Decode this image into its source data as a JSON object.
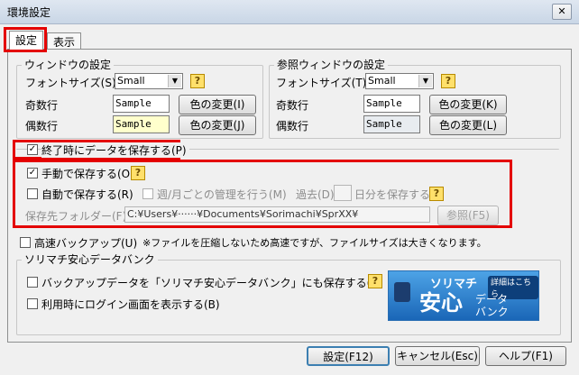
{
  "window": {
    "title": "環境設定",
    "close_glyph": "✕"
  },
  "tabs": [
    {
      "label": "設定"
    },
    {
      "label": "表示"
    }
  ],
  "window_settings": {
    "title": "ウィンドウの設定",
    "font_label": "フォントサイズ(S)",
    "font_value": "Small",
    "odd_label": "奇数行",
    "odd_sample": "Sample",
    "odd_button": "色の変更(I)",
    "even_label": "偶数行",
    "even_sample": "Sample",
    "even_button": "色の変更(J)"
  },
  "ref_window_settings": {
    "title": "参照ウィンドウの設定",
    "font_label": "フォントサイズ(T)",
    "font_value": "Small",
    "odd_label": "奇数行",
    "odd_sample": "Sample",
    "odd_button": "色の変更(K)",
    "even_label": "偶数行",
    "even_sample": "Sample",
    "even_button": "色の変更(L)"
  },
  "save_on_exit": {
    "label": "終了時にデータを保存する(P)",
    "checked": true
  },
  "manual_save": {
    "label": "手動で保存する(O)",
    "checked": true
  },
  "auto_save": {
    "label": "自動で保存する(R)",
    "checked": false,
    "weekly_label": "週/月ごとの管理を行う(M)",
    "past_label": "過去(D)",
    "days_label": "日分を保存する"
  },
  "save_folder": {
    "label": "保存先フォルダー(F)",
    "path": "C:¥Users¥······¥Documents¥Sorimachi¥SprXX¥",
    "browse_button": "参照(F5)"
  },
  "fast_backup": {
    "label": "高速バックアップ(U)",
    "note": "※ファイルを圧縮しないため高速ですが、ファイルサイズは大きくなります。",
    "checked": false
  },
  "data_bank": {
    "title": "ソリマチ安心データバンク",
    "backup_label": "バックアップデータを「ソリマチ安心データバンク」にも保存する(A)",
    "login_label": "利用時にログイン画面を表示する(B)",
    "banner_line1": "ソリマチ",
    "banner_line2": "安心",
    "banner_line3": "データ",
    "banner_line4": "バンク",
    "banner_badge": "詳細はこちら"
  },
  "footer": {
    "ok": "設定(F12)",
    "cancel": "キャンセル(Esc)",
    "help": "ヘルプ(F1)"
  },
  "help_glyph": "?",
  "check_glyph": "✓",
  "arrow_glyph": "▼",
  "colors": {
    "odd_bg": "#ffffff",
    "even_bg_left": "#ffffcc",
    "even_bg_right": "#e8ecf0",
    "highlight": "#e40000"
  }
}
